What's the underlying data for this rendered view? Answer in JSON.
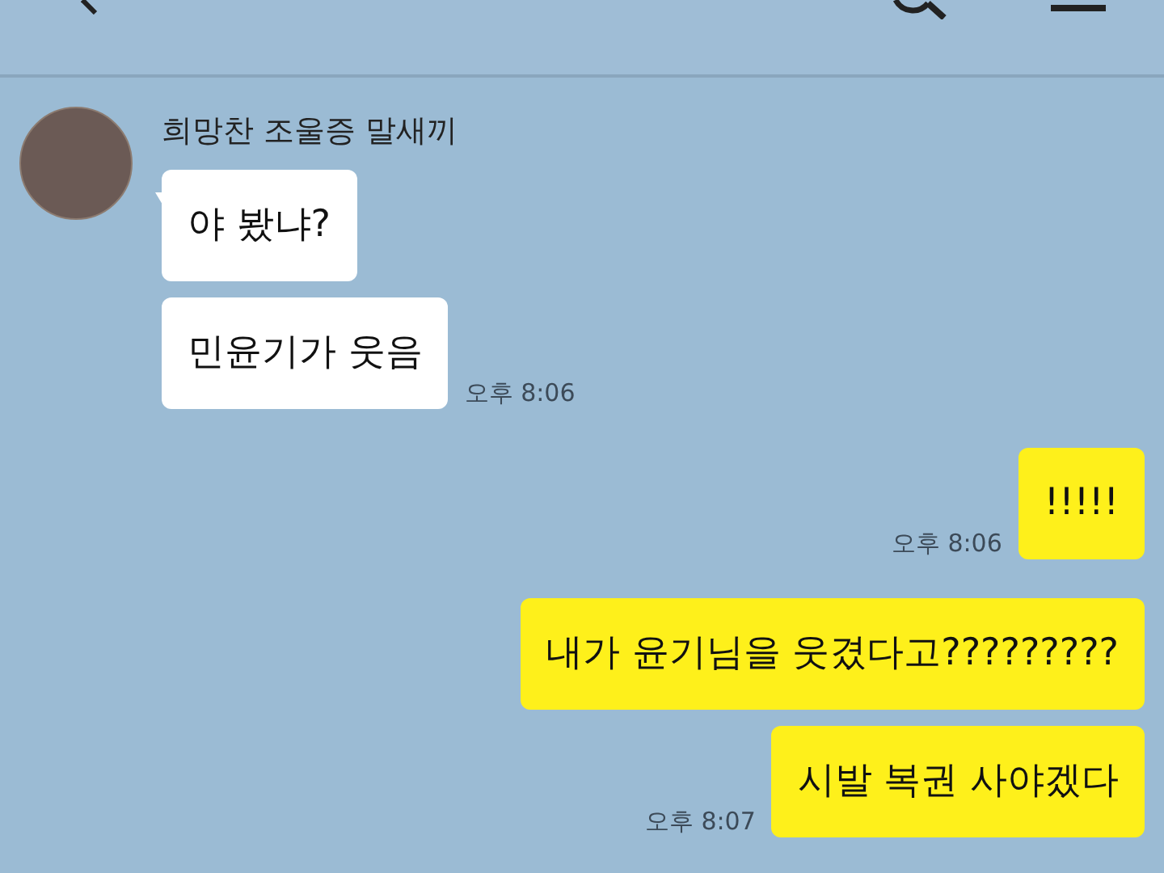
{
  "groups": [
    {
      "kind": "received",
      "sender": "희망찬 조울증 말새끼",
      "messages": [
        {
          "text": "야 봤냐?"
        },
        {
          "text": "민윤기가 웃음",
          "time": "오후 8:06"
        }
      ]
    },
    {
      "kind": "sent",
      "messages": [
        {
          "text": "!!!!!",
          "time": "오후 8:06"
        }
      ]
    },
    {
      "kind": "sent",
      "messages": [
        {
          "text": "내가 윤기님을 웃겼다고?????????"
        },
        {
          "text": "시발 복권 사야겠다",
          "time": "오후 8:07"
        }
      ]
    }
  ]
}
